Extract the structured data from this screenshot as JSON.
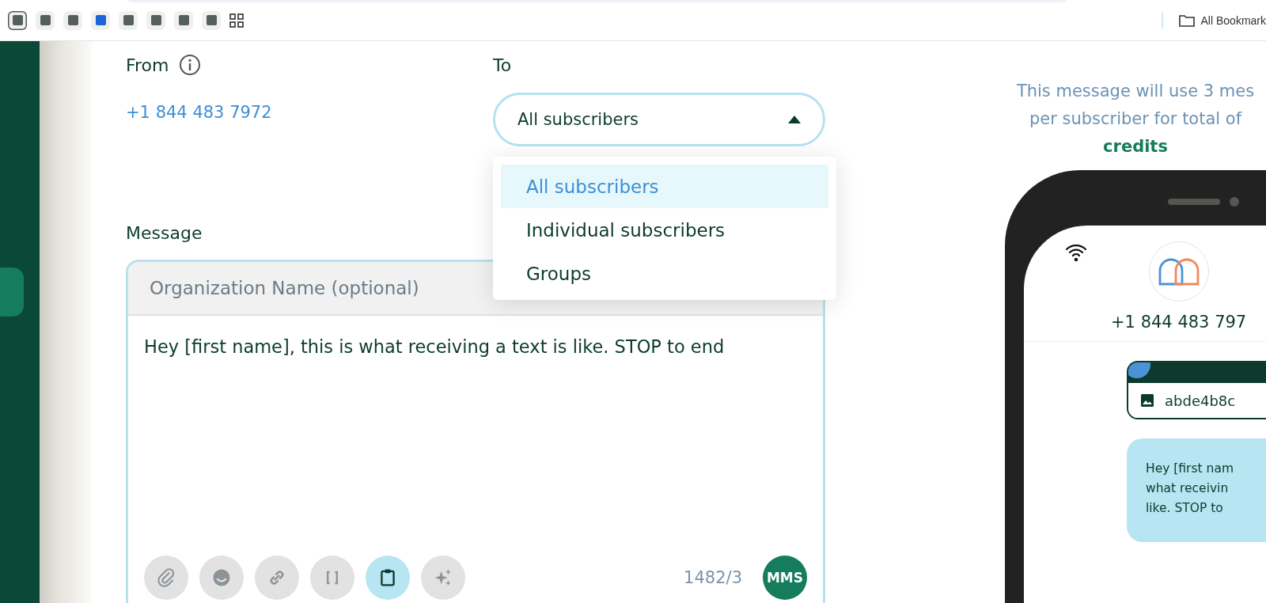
{
  "bookmarks_bar": {
    "folder": "All Bookmark"
  },
  "form": {
    "from": {
      "label": "From",
      "value": "+1 844 483 7972"
    },
    "to": {
      "label": "To",
      "value": "All subscribers",
      "expanded": true,
      "options": [
        {
          "label": "All subscribers",
          "selected": true
        },
        {
          "label": "Individual subscribers",
          "selected": false
        },
        {
          "label": "Groups",
          "selected": false
        }
      ]
    },
    "message": {
      "label": "Message",
      "org_placeholder": "Organization Name (optional)",
      "text": "Hey [first name], this is what receiving a text is like. STOP to end",
      "tools": [
        {
          "kind": "attach",
          "active": false
        },
        {
          "kind": "emoji",
          "active": false
        },
        {
          "kind": "link",
          "active": false
        },
        {
          "kind": "brackets",
          "active": false
        },
        {
          "kind": "clipboard",
          "active": true
        },
        {
          "kind": "sparkle",
          "active": false
        }
      ],
      "counter": "1482/3",
      "type_badge": "MMS"
    }
  },
  "preview": {
    "info_lines": [
      "This message will use 3 mes",
      "per subscriber for total of"
    ],
    "info_emphasis": "credits",
    "phone": {
      "number": "+1 844 483 797",
      "attachment": "abde4b8c",
      "bubble_lines": [
        "Hey [first nam",
        "what receivin",
        "like. STOP to"
      ]
    }
  }
}
